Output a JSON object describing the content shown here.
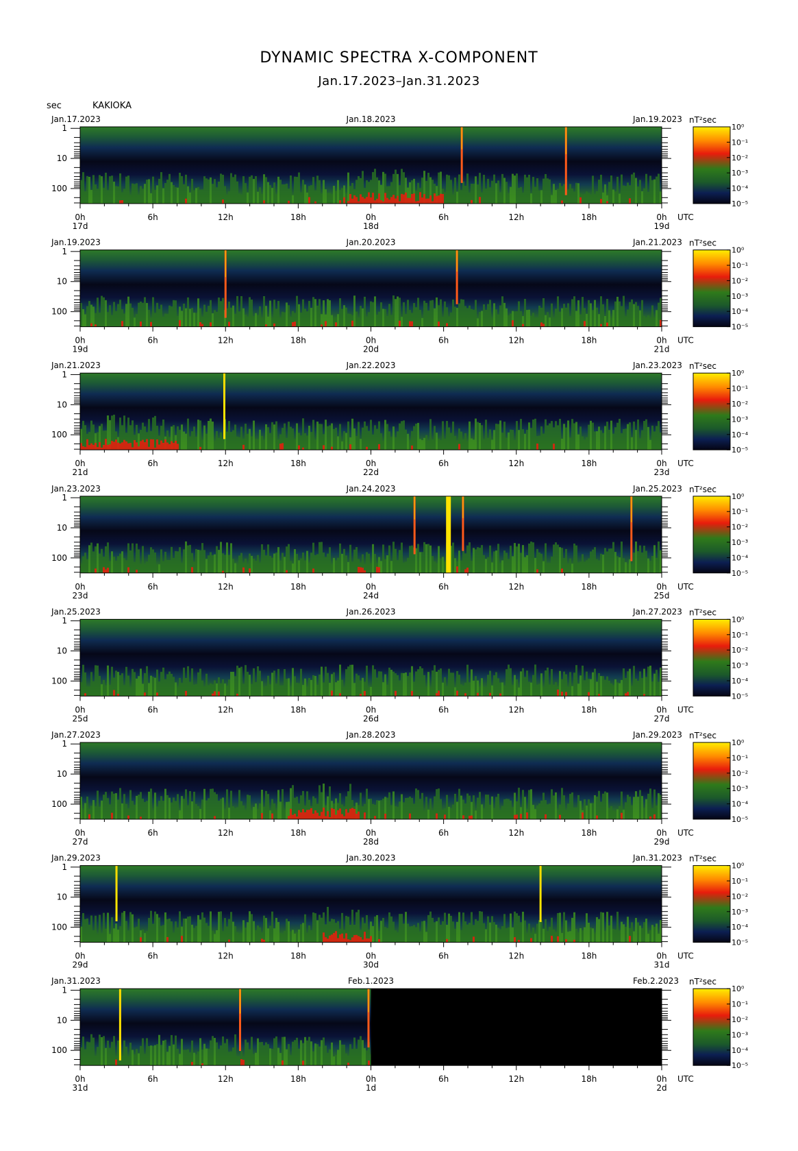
{
  "title": "DYNAMIC SPECTRA X-COMPONENT",
  "subtitle": "Jan.17.2023–Jan.31.2023",
  "unit_label": "sec",
  "station": "KAKIOKA",
  "colors": {
    "low": "#0a0a2a",
    "mid": "#2f7f1f",
    "high": "#e02010",
    "max": "#ffe800"
  },
  "chart_data": {
    "type": "heatmap",
    "y_axis": {
      "label": "sec",
      "scale": "log",
      "ticks": [
        "1",
        "10",
        "100"
      ],
      "inverted": true
    },
    "x_ticks": [
      "0h",
      "6h",
      "12h",
      "18h",
      "0h",
      "6h",
      "12h",
      "18h",
      "0h"
    ],
    "x_unit": "UTC",
    "colorbar": {
      "unit": "nT²sec",
      "ticks": [
        "10⁰",
        "10⁻¹",
        "10⁻²",
        "10⁻³",
        "10⁻⁴",
        "10⁻⁵"
      ]
    },
    "panels": [
      {
        "start_label": "Jan.17.2023",
        "mid_label": "Jan.18.2023",
        "end_label": "Jan.19.2023",
        "day_labels": [
          "17d",
          "18d",
          "19d"
        ],
        "spikes": [
          {
            "hour": 31.5,
            "color": "red"
          },
          {
            "hour": 40.1,
            "color": "red"
          }
        ],
        "red_regions": [
          [
            22,
            30
          ]
        ],
        "no_data_from_hour": null
      },
      {
        "start_label": "Jan.19.2023",
        "mid_label": "Jan.20.2023",
        "end_label": "Jan.21.2023",
        "day_labels": [
          "19d",
          "20d",
          "21d"
        ],
        "spikes": [
          {
            "hour": 12.0,
            "color": "red"
          },
          {
            "hour": 31.1,
            "color": "red"
          }
        ],
        "red_regions": [],
        "no_data_from_hour": null
      },
      {
        "start_label": "Jan.21.2023",
        "mid_label": "Jan.22.2023",
        "end_label": "Jan.23.2023",
        "day_labels": [
          "21d",
          "22d",
          "23d"
        ],
        "spikes": [
          {
            "hour": 11.9,
            "color": "yellow"
          }
        ],
        "red_regions": [
          [
            0,
            8
          ]
        ],
        "no_data_from_hour": null
      },
      {
        "start_label": "Jan.23.2023",
        "mid_label": "Jan.24.2023",
        "end_label": "Jan.25.2023",
        "day_labels": [
          "23d",
          "24d",
          "25d"
        ],
        "spikes": [
          {
            "hour": 27.6,
            "color": "red"
          },
          {
            "hour": 30.4,
            "color": "yellow",
            "wide": true
          },
          {
            "hour": 31.6,
            "color": "red"
          },
          {
            "hour": 45.5,
            "color": "red"
          }
        ],
        "red_regions": [],
        "no_data_from_hour": null
      },
      {
        "start_label": "Jan.25.2023",
        "mid_label": "Jan.26.2023",
        "end_label": "Jan.27.2023",
        "day_labels": [
          "25d",
          "26d",
          "27d"
        ],
        "spikes": [],
        "red_regions": [],
        "no_data_from_hour": null
      },
      {
        "start_label": "Jan.27.2023",
        "mid_label": "Jan.28.2023",
        "end_label": "Jan.29.2023",
        "day_labels": [
          "27d",
          "28d",
          "29d"
        ],
        "spikes": [],
        "red_regions": [
          [
            17,
            23
          ]
        ],
        "no_data_from_hour": null
      },
      {
        "start_label": "Jan.29.2023",
        "mid_label": "Jan.30.2023",
        "end_label": "Jan.31.2023",
        "day_labels": [
          "29d",
          "30d",
          "31d"
        ],
        "spikes": [
          {
            "hour": 3.0,
            "color": "yellow"
          },
          {
            "hour": 38.0,
            "color": "yellow"
          }
        ],
        "red_regions": [
          [
            20,
            24
          ]
        ],
        "no_data_from_hour": null
      },
      {
        "start_label": "Jan.31.2023",
        "mid_label": "Feb.1.2023",
        "end_label": "Feb.2.2023",
        "day_labels": [
          "31d",
          "1d",
          "2d"
        ],
        "spikes": [
          {
            "hour": 3.3,
            "color": "yellow"
          },
          {
            "hour": 13.2,
            "color": "red"
          },
          {
            "hour": 23.8,
            "color": "red"
          }
        ],
        "red_regions": [],
        "no_data_from_hour": 24
      }
    ]
  }
}
